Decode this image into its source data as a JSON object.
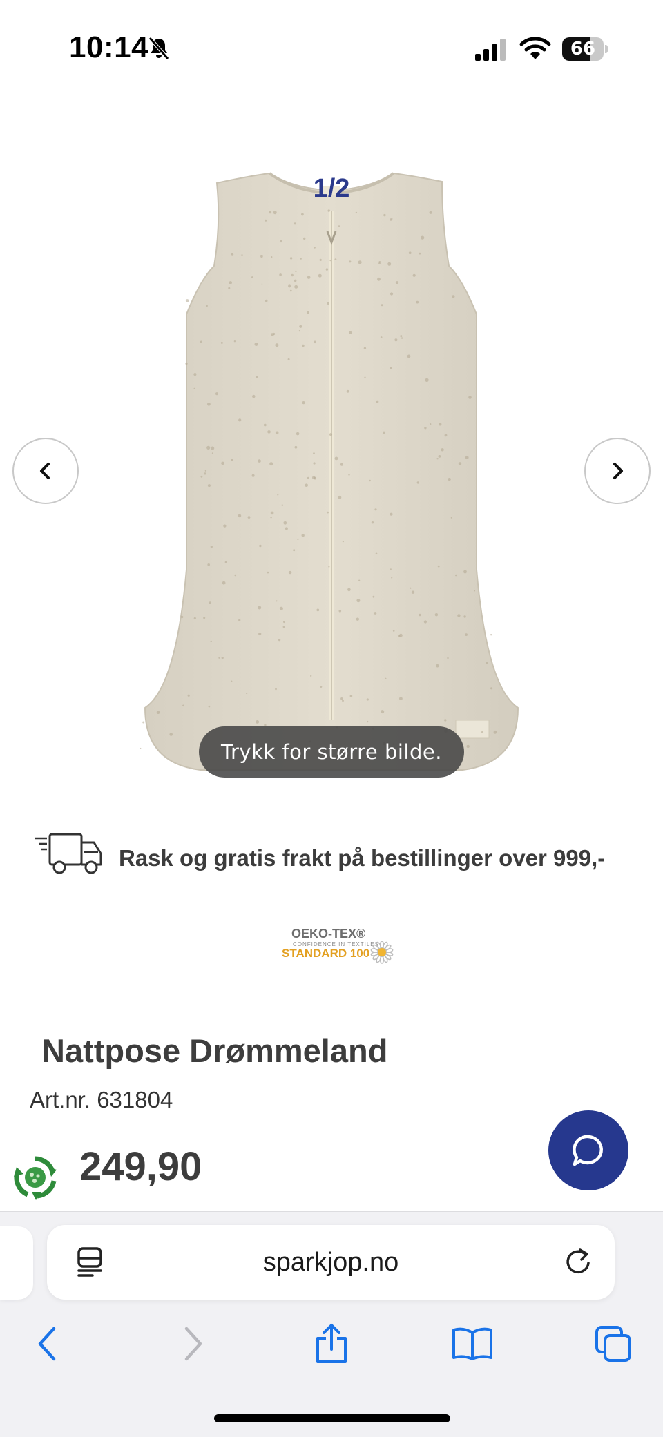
{
  "status_bar": {
    "time": "10:14",
    "battery_level": "66"
  },
  "gallery": {
    "counter": "1/2",
    "enlarge_hint": "Trykk for større bilde."
  },
  "shipping": {
    "text": "Rask og gratis frakt på bestillinger over 999,-"
  },
  "certification": {
    "line1": "OEKO-TEX®",
    "line2": "CONFIDENCE IN TEXTILES",
    "line3": "STANDARD 100"
  },
  "product": {
    "title": "Nattpose Drømmeland",
    "article_number": "Art.nr. 631804",
    "price": "249,90"
  },
  "browser": {
    "url": "sparkjop.no"
  },
  "colors": {
    "brand_blue": "#26388e",
    "counter_blue": "#2b3a8c",
    "ios_blue": "#1a73e8",
    "oeko_orange": "#e3a021",
    "recycle_green": "#2e8b3a"
  },
  "icons": [
    "bell-muted-icon",
    "signal-icon",
    "wifi-icon",
    "battery-icon",
    "chevron-left-icon",
    "chevron-right-icon",
    "truck-icon",
    "daisy-icon",
    "recycle-icon",
    "chat-bubble-icon",
    "reader-icon",
    "reload-icon",
    "back-icon",
    "forward-icon",
    "share-icon",
    "bookmarks-icon",
    "tabs-icon"
  ]
}
